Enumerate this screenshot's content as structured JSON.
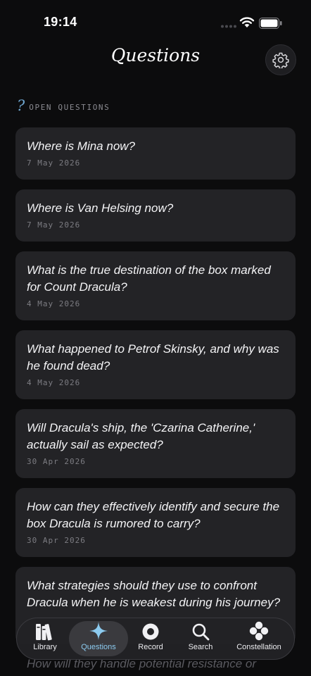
{
  "status_bar": {
    "time": "19:14"
  },
  "header": {
    "title": "Questions",
    "settings_icon": "gear-icon"
  },
  "section": {
    "label": "OPEN QUESTIONS",
    "icon_glyph": "?"
  },
  "questions": [
    {
      "text": "Where is Mina now?",
      "date": "7 May 2026"
    },
    {
      "text": "Where is Van Helsing now?",
      "date": "7 May 2026"
    },
    {
      "text": "What is the true destination of the box marked for Count Dracula?",
      "date": "4 May 2026"
    },
    {
      "text": "What happened to Petrof Skinsky, and why was he found dead?",
      "date": "4 May 2026"
    },
    {
      "text": "Will Dracula's ship, the 'Czarina Catherine,' actually sail as expected?",
      "date": "30 Apr 2026"
    },
    {
      "text": "How can they effectively identify and secure the box Dracula is rumored to carry?",
      "date": "30 Apr 2026"
    },
    {
      "text": "What strategies should they use to confront Dracula when he is weakest during his journey?",
      "date": ""
    },
    {
      "text": "How will they handle potential resistance or",
      "date": ""
    }
  ],
  "tabbar": {
    "tabs": [
      {
        "label": "Library",
        "icon": "books-icon"
      },
      {
        "label": "Questions",
        "icon": "sparkle-icon",
        "active": true
      },
      {
        "label": "Record",
        "icon": "record-icon"
      },
      {
        "label": "Search",
        "icon": "search-icon"
      },
      {
        "label": "Constellation",
        "icon": "constellation-icon"
      }
    ]
  },
  "colors": {
    "accent": "#8ccbf0",
    "question_mark": "#6fa6cf",
    "card": "#232326",
    "background": "#0c0c0d"
  }
}
